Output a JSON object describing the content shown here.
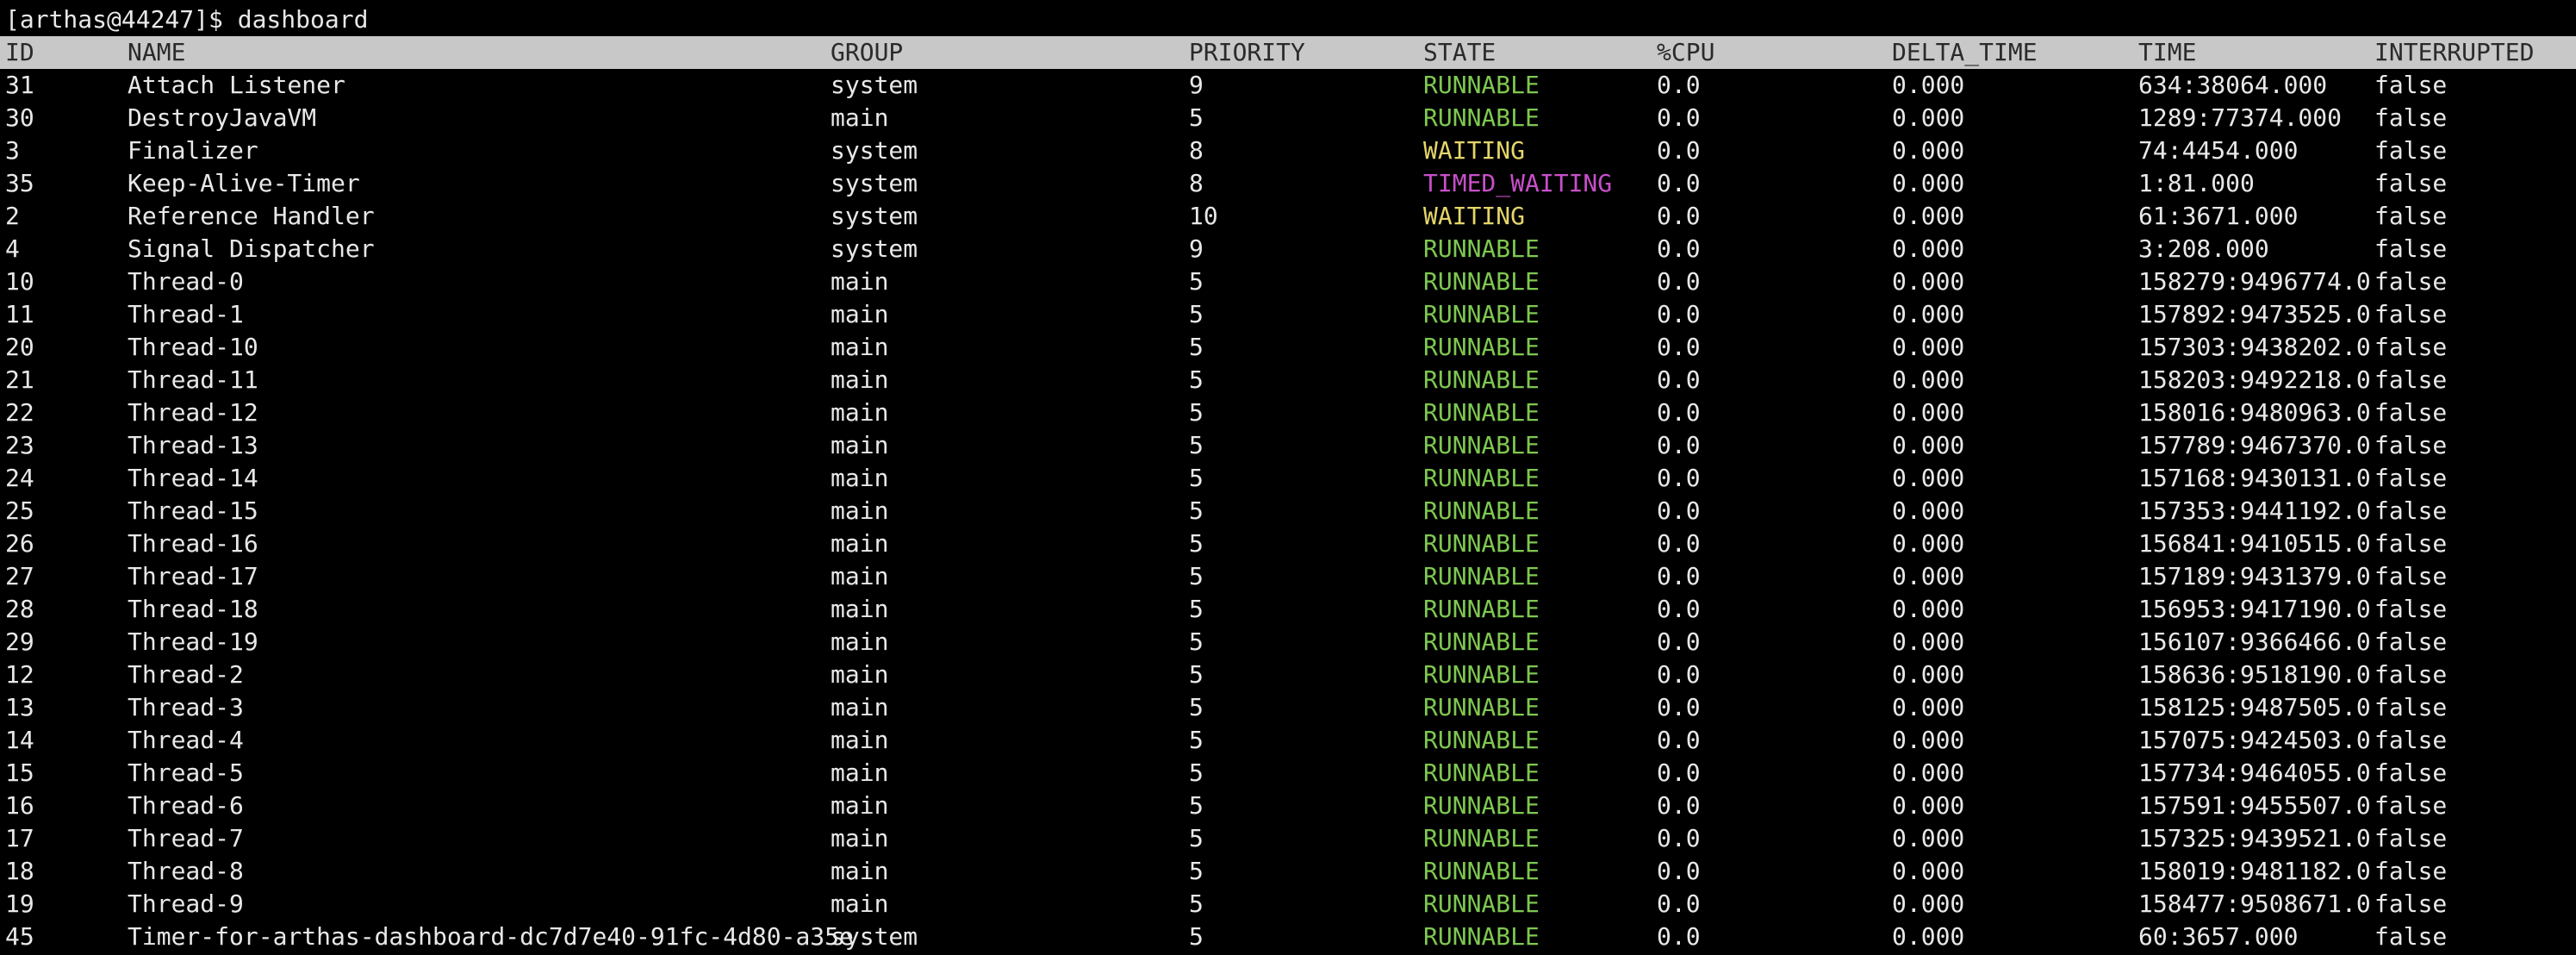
{
  "terminal": {
    "prompt": "[arthas@44247]$ dashboard"
  },
  "table": {
    "headers": {
      "id": "ID",
      "name": "NAME",
      "group": "GROUP",
      "priority": "PRIORITY",
      "state": "STATE",
      "cpu": "%CPU",
      "delta_time": "DELTA_TIME",
      "time": "TIME",
      "interrupted": "INTERRUPTED"
    },
    "state_colors": {
      "RUNNABLE": "#7ec850",
      "WAITING": "#e4d66a",
      "TIMED_WAITING": "#c74fc8"
    },
    "rows": [
      {
        "id": "31",
        "name": "Attach Listener",
        "group": "system",
        "priority": "9",
        "state": "RUNNABLE",
        "cpu": "0.0",
        "delta_time": "0.000",
        "time": "634:38064.000",
        "interrupted": "false"
      },
      {
        "id": "30",
        "name": "DestroyJavaVM",
        "group": "main",
        "priority": "5",
        "state": "RUNNABLE",
        "cpu": "0.0",
        "delta_time": "0.000",
        "time": "1289:77374.000",
        "interrupted": "false"
      },
      {
        "id": "3",
        "name": "Finalizer",
        "group": "system",
        "priority": "8",
        "state": "WAITING",
        "cpu": "0.0",
        "delta_time": "0.000",
        "time": "74:4454.000",
        "interrupted": "false"
      },
      {
        "id": "35",
        "name": "Keep-Alive-Timer",
        "group": "system",
        "priority": "8",
        "state": "TIMED_WAITING",
        "cpu": "0.0",
        "delta_time": "0.000",
        "time": "1:81.000",
        "interrupted": "false"
      },
      {
        "id": "2",
        "name": "Reference Handler",
        "group": "system",
        "priority": "10",
        "state": "WAITING",
        "cpu": "0.0",
        "delta_time": "0.000",
        "time": "61:3671.000",
        "interrupted": "false"
      },
      {
        "id": "4",
        "name": "Signal Dispatcher",
        "group": "system",
        "priority": "9",
        "state": "RUNNABLE",
        "cpu": "0.0",
        "delta_time": "0.000",
        "time": "3:208.000",
        "interrupted": "false"
      },
      {
        "id": "10",
        "name": "Thread-0",
        "group": "main",
        "priority": "5",
        "state": "RUNNABLE",
        "cpu": "0.0",
        "delta_time": "0.000",
        "time": "158279:9496774.0",
        "interrupted": "false"
      },
      {
        "id": "11",
        "name": "Thread-1",
        "group": "main",
        "priority": "5",
        "state": "RUNNABLE",
        "cpu": "0.0",
        "delta_time": "0.000",
        "time": "157892:9473525.0",
        "interrupted": "false"
      },
      {
        "id": "20",
        "name": "Thread-10",
        "group": "main",
        "priority": "5",
        "state": "RUNNABLE",
        "cpu": "0.0",
        "delta_time": "0.000",
        "time": "157303:9438202.0",
        "interrupted": "false"
      },
      {
        "id": "21",
        "name": "Thread-11",
        "group": "main",
        "priority": "5",
        "state": "RUNNABLE",
        "cpu": "0.0",
        "delta_time": "0.000",
        "time": "158203:9492218.0",
        "interrupted": "false"
      },
      {
        "id": "22",
        "name": "Thread-12",
        "group": "main",
        "priority": "5",
        "state": "RUNNABLE",
        "cpu": "0.0",
        "delta_time": "0.000",
        "time": "158016:9480963.0",
        "interrupted": "false"
      },
      {
        "id": "23",
        "name": "Thread-13",
        "group": "main",
        "priority": "5",
        "state": "RUNNABLE",
        "cpu": "0.0",
        "delta_time": "0.000",
        "time": "157789:9467370.0",
        "interrupted": "false"
      },
      {
        "id": "24",
        "name": "Thread-14",
        "group": "main",
        "priority": "5",
        "state": "RUNNABLE",
        "cpu": "0.0",
        "delta_time": "0.000",
        "time": "157168:9430131.0",
        "interrupted": "false"
      },
      {
        "id": "25",
        "name": "Thread-15",
        "group": "main",
        "priority": "5",
        "state": "RUNNABLE",
        "cpu": "0.0",
        "delta_time": "0.000",
        "time": "157353:9441192.0",
        "interrupted": "false"
      },
      {
        "id": "26",
        "name": "Thread-16",
        "group": "main",
        "priority": "5",
        "state": "RUNNABLE",
        "cpu": "0.0",
        "delta_time": "0.000",
        "time": "156841:9410515.0",
        "interrupted": "false"
      },
      {
        "id": "27",
        "name": "Thread-17",
        "group": "main",
        "priority": "5",
        "state": "RUNNABLE",
        "cpu": "0.0",
        "delta_time": "0.000",
        "time": "157189:9431379.0",
        "interrupted": "false"
      },
      {
        "id": "28",
        "name": "Thread-18",
        "group": "main",
        "priority": "5",
        "state": "RUNNABLE",
        "cpu": "0.0",
        "delta_time": "0.000",
        "time": "156953:9417190.0",
        "interrupted": "false"
      },
      {
        "id": "29",
        "name": "Thread-19",
        "group": "main",
        "priority": "5",
        "state": "RUNNABLE",
        "cpu": "0.0",
        "delta_time": "0.000",
        "time": "156107:9366466.0",
        "interrupted": "false"
      },
      {
        "id": "12",
        "name": "Thread-2",
        "group": "main",
        "priority": "5",
        "state": "RUNNABLE",
        "cpu": "0.0",
        "delta_time": "0.000",
        "time": "158636:9518190.0",
        "interrupted": "false"
      },
      {
        "id": "13",
        "name": "Thread-3",
        "group": "main",
        "priority": "5",
        "state": "RUNNABLE",
        "cpu": "0.0",
        "delta_time": "0.000",
        "time": "158125:9487505.0",
        "interrupted": "false"
      },
      {
        "id": "14",
        "name": "Thread-4",
        "group": "main",
        "priority": "5",
        "state": "RUNNABLE",
        "cpu": "0.0",
        "delta_time": "0.000",
        "time": "157075:9424503.0",
        "interrupted": "false"
      },
      {
        "id": "15",
        "name": "Thread-5",
        "group": "main",
        "priority": "5",
        "state": "RUNNABLE",
        "cpu": "0.0",
        "delta_time": "0.000",
        "time": "157734:9464055.0",
        "interrupted": "false"
      },
      {
        "id": "16",
        "name": "Thread-6",
        "group": "main",
        "priority": "5",
        "state": "RUNNABLE",
        "cpu": "0.0",
        "delta_time": "0.000",
        "time": "157591:9455507.0",
        "interrupted": "false"
      },
      {
        "id": "17",
        "name": "Thread-7",
        "group": "main",
        "priority": "5",
        "state": "RUNNABLE",
        "cpu": "0.0",
        "delta_time": "0.000",
        "time": "157325:9439521.0",
        "interrupted": "false"
      },
      {
        "id": "18",
        "name": "Thread-8",
        "group": "main",
        "priority": "5",
        "state": "RUNNABLE",
        "cpu": "0.0",
        "delta_time": "0.000",
        "time": "158019:9481182.0",
        "interrupted": "false"
      },
      {
        "id": "19",
        "name": "Thread-9",
        "group": "main",
        "priority": "5",
        "state": "RUNNABLE",
        "cpu": "0.0",
        "delta_time": "0.000",
        "time": "158477:9508671.0",
        "interrupted": "false"
      },
      {
        "id": "45",
        "name": "Timer-for-arthas-dashboard-dc7d7e40-91fc-4d80-a35e",
        "group": "system",
        "priority": "5",
        "state": "RUNNABLE",
        "cpu": "0.0",
        "delta_time": "0.000",
        "time": "60:3657.000",
        "interrupted": "false"
      }
    ]
  }
}
